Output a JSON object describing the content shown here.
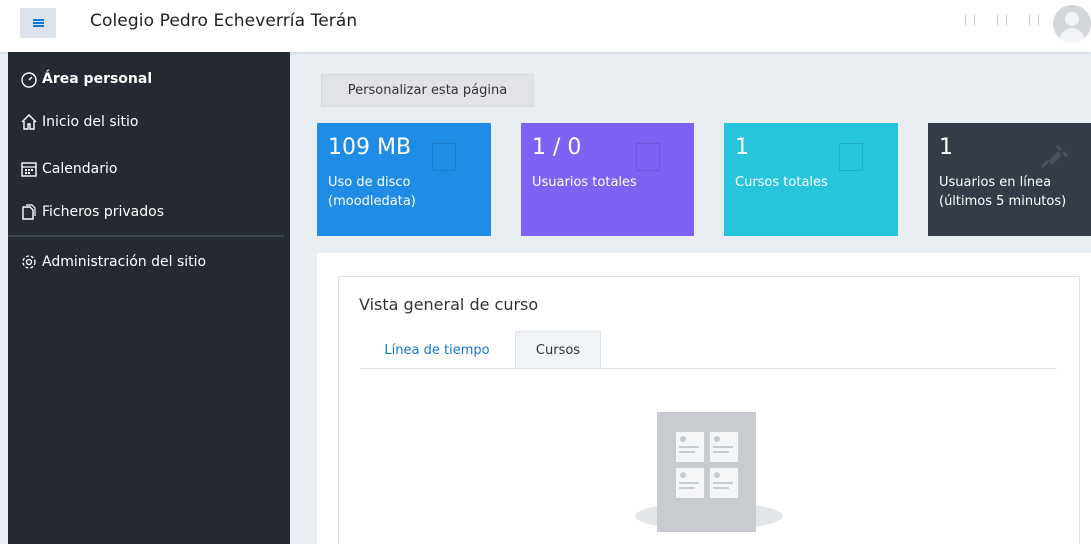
{
  "navbar": {
    "site_name": "Colegio Pedro Echeverría Terán"
  },
  "sidebar": {
    "items": [
      {
        "label": "Área personal",
        "icon": "dashboard-icon"
      },
      {
        "label": "Inicio del sitio",
        "icon": "home-icon"
      },
      {
        "label": "Calendario",
        "icon": "calendar-icon"
      },
      {
        "label": "Ficheros privados",
        "icon": "files-icon"
      },
      {
        "label": "Administración del sitio",
        "icon": "gear-icon"
      }
    ]
  },
  "main": {
    "customize_label": "Personalizar esta página",
    "stats": [
      {
        "value": "109 MB",
        "label": "Uso de disco (moodledata)",
        "color": "#1f8ce6"
      },
      {
        "value": "1 / 0",
        "label": "Usuarios totales",
        "color": "#7f62f3"
      },
      {
        "value": "1",
        "label": "Cursos totales",
        "color": "#26c5dc"
      },
      {
        "value": "1",
        "label": "Usuarios en línea (últimos 5 minutos)",
        "color": "#343c47"
      }
    ],
    "course_overview": {
      "title": "Vista general de curso",
      "tabs": [
        {
          "label": "Línea de tiempo",
          "active": false
        },
        {
          "label": "Cursos",
          "active": true
        }
      ]
    }
  },
  "colors": {
    "accent": "#1177d1",
    "sidebar_bg": "#252a32",
    "page_bg": "#e9eef2"
  }
}
